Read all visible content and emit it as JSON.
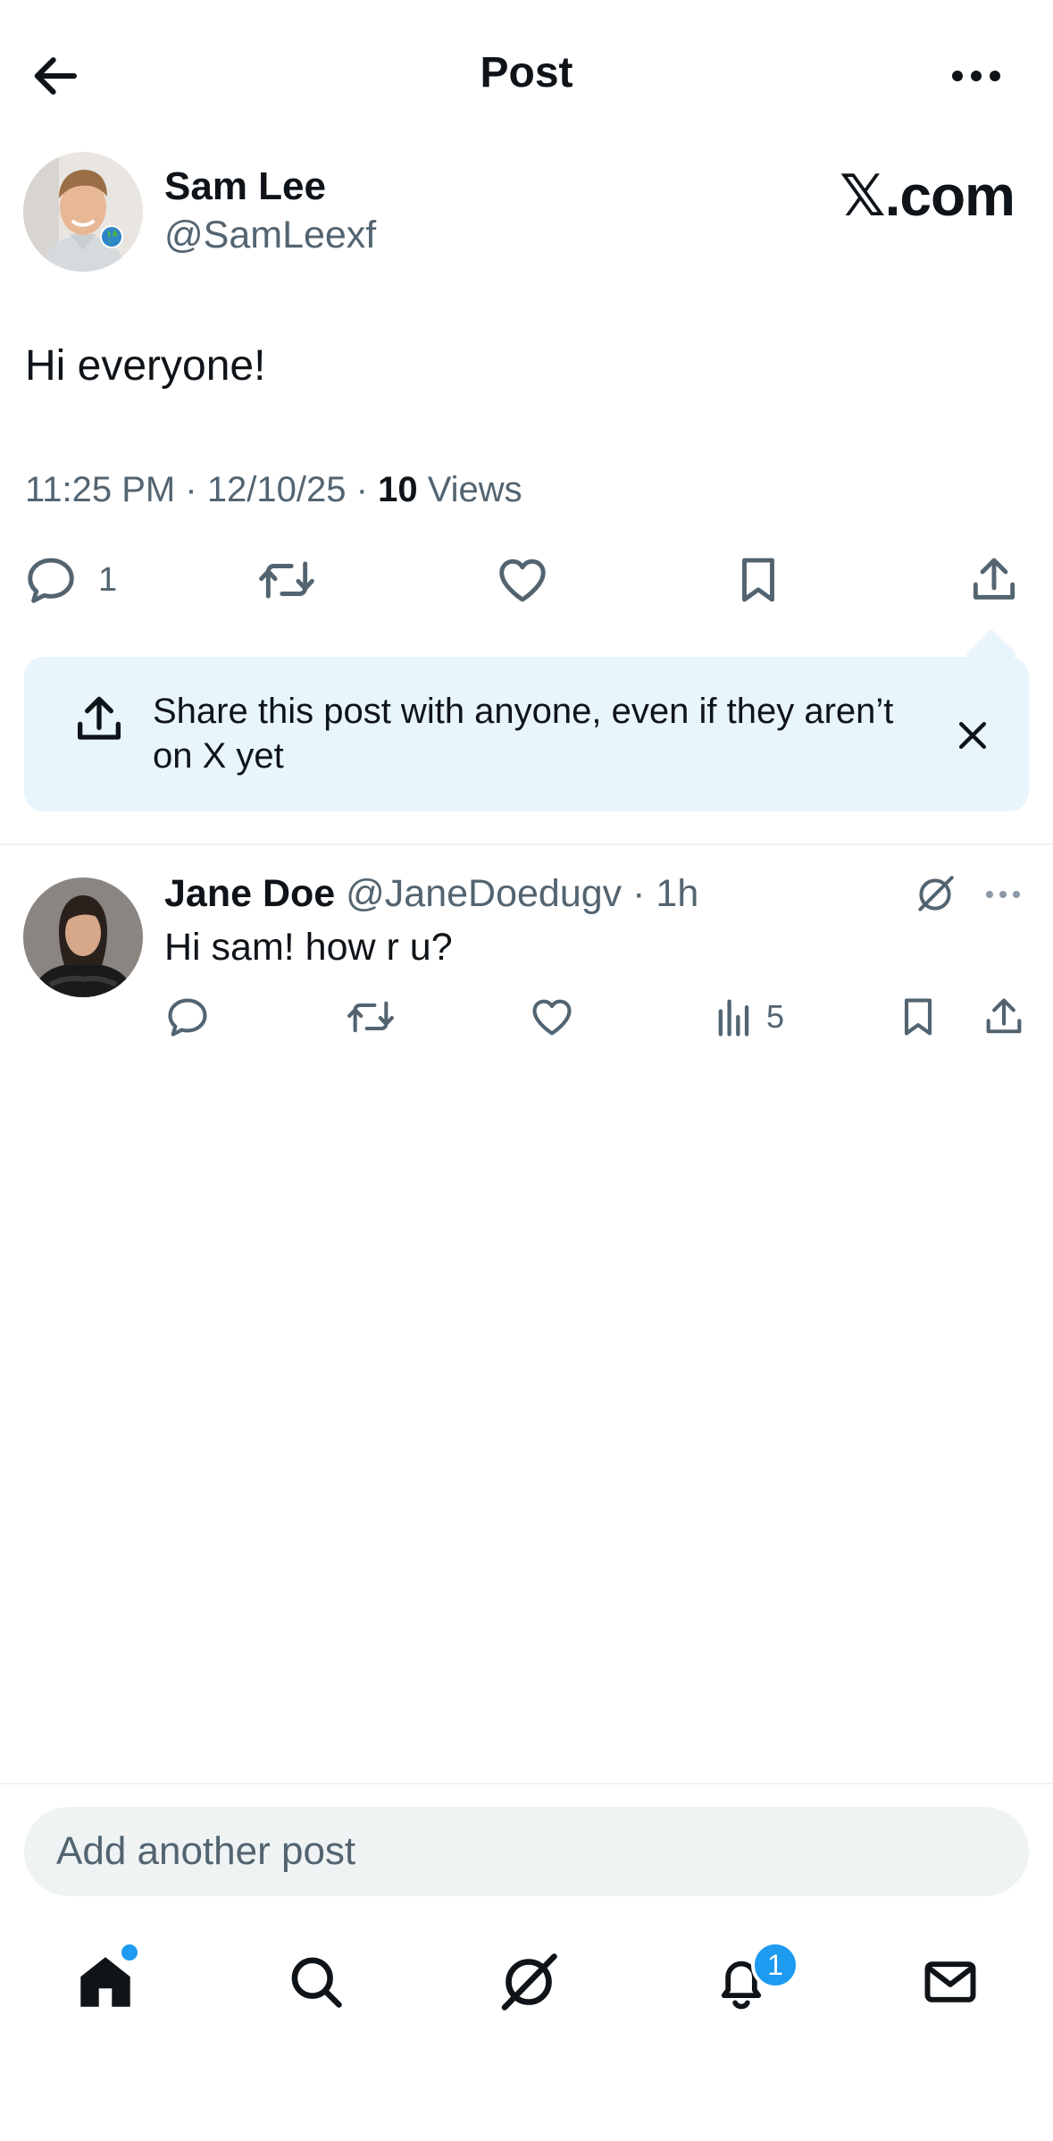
{
  "header": {
    "title": "Post"
  },
  "author": {
    "name": "Sam Lee",
    "handle": "@SamLeexf",
    "brand": "𝕏.com"
  },
  "post": {
    "text": "Hi everyone!",
    "time": "11:25 PM",
    "date": "12/10/25",
    "views_count": "10",
    "views_label": "Views",
    "reply_count": "1"
  },
  "share_tip": {
    "text": "Share this post with anyone, even if they aren’t on X yet"
  },
  "reply": {
    "name": "Jane Doe",
    "handle": "@JaneDoedugv",
    "time": "1h",
    "text": "Hi sam! how r u?",
    "views_count": "5"
  },
  "composer": {
    "placeholder": "Add another post"
  },
  "nav": {
    "notifications_badge": "1"
  },
  "colors": {
    "accent": "#1d9bf0",
    "tip_bg": "#e8f5fd",
    "muted": "#536471",
    "text": "#0f1419"
  }
}
